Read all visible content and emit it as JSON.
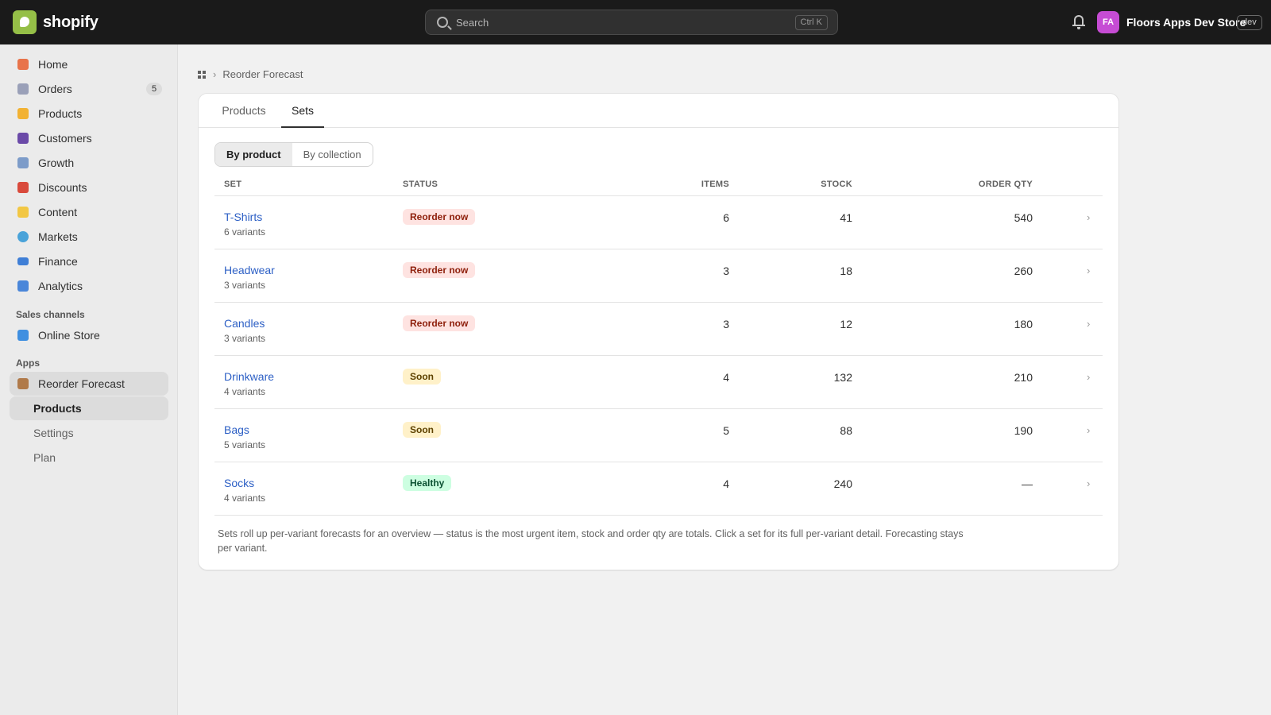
{
  "topbar": {
    "brand": "shopify",
    "search_placeholder": "Search",
    "search_shortcut": "Ctrl K",
    "avatar_initials": "FA",
    "store_name": "Floors Apps Dev Store",
    "env_badge": "dev"
  },
  "sidebar": {
    "items": [
      {
        "label": "Home",
        "icon": "home-icon",
        "color": "#e8734a"
      },
      {
        "label": "Orders",
        "icon": "orders-icon",
        "color": "#9aa0b8",
        "count": "5"
      },
      {
        "label": "Products",
        "icon": "tag-icon",
        "color": "#f2b233"
      },
      {
        "label": "Customers",
        "icon": "people-icon",
        "color": "#6b4aa8"
      },
      {
        "label": "Growth",
        "icon": "chart-up-icon",
        "color": "#7d9cc9"
      },
      {
        "label": "Discounts",
        "icon": "gift-icon",
        "color": "#d94a3c"
      },
      {
        "label": "Content",
        "icon": "folder-icon",
        "color": "#f2c744"
      },
      {
        "label": "Markets",
        "icon": "globe-icon",
        "color": "#4aa3d9"
      },
      {
        "label": "Finance",
        "icon": "card-icon",
        "color": "#3f7fd6"
      },
      {
        "label": "Analytics",
        "icon": "bar-chart-icon",
        "color": "#4a86d9"
      }
    ],
    "sales_channels_heading": "Sales channels",
    "online_store": {
      "label": "Online Store",
      "icon": "shopping-bag-icon",
      "color": "#3f8fe0"
    },
    "apps_heading": "Apps",
    "app": {
      "label": "Reorder Forecast",
      "icon": "box-icon",
      "color": "#b07a4a"
    },
    "app_sub_items": [
      {
        "label": "Products",
        "active": true
      },
      {
        "label": "Settings",
        "active": false
      },
      {
        "label": "Plan",
        "active": false
      }
    ]
  },
  "breadcrumb": {
    "current": "Reorder Forecast"
  },
  "tabs": [
    {
      "label": "Products",
      "active": false
    },
    {
      "label": "Sets",
      "active": true
    }
  ],
  "segmented": [
    {
      "label": "By product",
      "active": true
    },
    {
      "label": "By collection",
      "active": false
    }
  ],
  "table": {
    "headers": {
      "set": "SET",
      "status": "STATUS",
      "items": "ITEMS",
      "stock": "STOCK",
      "order_qty": "ORDER QTY"
    },
    "rows": [
      {
        "name": "T-Shirts",
        "variants": "6 variants",
        "status": "Reorder now",
        "status_kind": "critical",
        "items": "6",
        "stock": "41",
        "order_qty": "540"
      },
      {
        "name": "Headwear",
        "variants": "3 variants",
        "status": "Reorder now",
        "status_kind": "critical",
        "items": "3",
        "stock": "18",
        "order_qty": "260"
      },
      {
        "name": "Candles",
        "variants": "3 variants",
        "status": "Reorder now",
        "status_kind": "critical",
        "items": "3",
        "stock": "12",
        "order_qty": "180"
      },
      {
        "name": "Drinkware",
        "variants": "4 variants",
        "status": "Soon",
        "status_kind": "warning",
        "items": "4",
        "stock": "132",
        "order_qty": "210"
      },
      {
        "name": "Bags",
        "variants": "5 variants",
        "status": "Soon",
        "status_kind": "warning",
        "items": "5",
        "stock": "88",
        "order_qty": "190"
      },
      {
        "name": "Socks",
        "variants": "4 variants",
        "status": "Healthy",
        "status_kind": "success",
        "items": "4",
        "stock": "240",
        "order_qty": "—"
      }
    ]
  },
  "status_colors": {
    "critical": {
      "bg": "#fee3e1",
      "fg": "#8e1f0b"
    },
    "warning": {
      "bg": "#fff1c9",
      "fg": "#5e4200"
    },
    "success": {
      "bg": "#cdfee1",
      "fg": "#0c5132"
    }
  },
  "footnote": "Sets roll up per-variant forecasts for an overview — status is the most urgent item, stock and order qty are totals. Click a set for its full per-variant detail. Forecasting stays per variant."
}
